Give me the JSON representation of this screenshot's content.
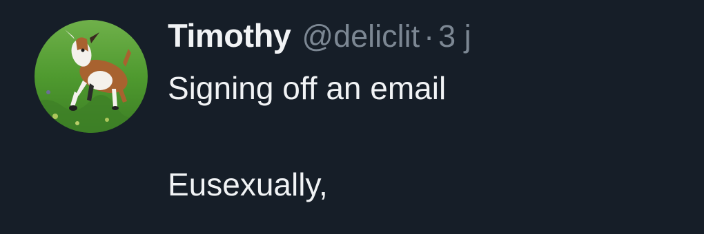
{
  "tweet": {
    "author": {
      "display_name": "Timothy",
      "handle": "@deliclit",
      "avatar_icon": "goat-avatar-icon"
    },
    "separator": "·",
    "timestamp": "3 j",
    "text_lines": [
      "Signing off an email",
      "Eusexually,"
    ]
  },
  "colors": {
    "background": "#161e28",
    "primary_text": "#f1f3f5",
    "secondary_text": "#7c8793"
  }
}
